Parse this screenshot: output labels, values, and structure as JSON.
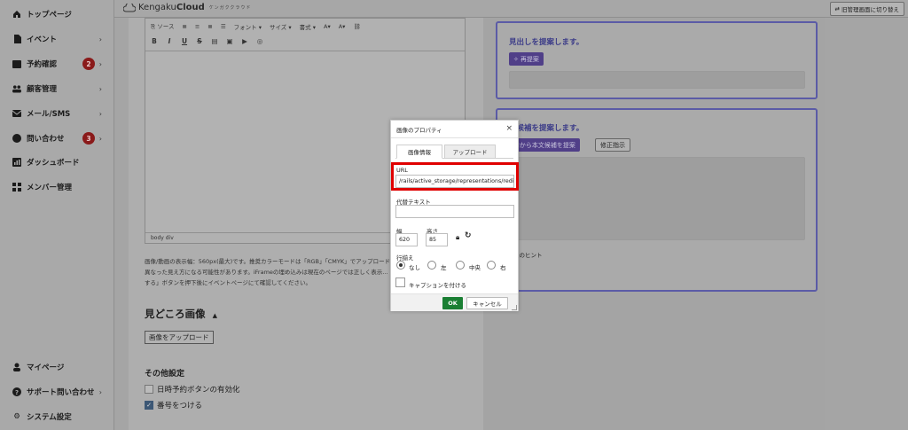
{
  "sidebar": {
    "items": [
      {
        "label": "トップページ",
        "icon": "home-icon",
        "chevron": false,
        "badge": ""
      },
      {
        "label": "イベント",
        "icon": "document-icon",
        "chevron": true,
        "badge": ""
      },
      {
        "label": "予約確認",
        "icon": "calendar-icon",
        "chevron": true,
        "badge": "2"
      },
      {
        "label": "顧客管理",
        "icon": "users-icon",
        "chevron": true,
        "badge": ""
      },
      {
        "label": "メール/SMS",
        "icon": "mail-icon",
        "chevron": true,
        "badge": ""
      },
      {
        "label": "問い合わせ",
        "icon": "chat-icon",
        "chevron": true,
        "badge": "3"
      },
      {
        "label": "ダッシュボード",
        "icon": "chart-icon",
        "chevron": false,
        "badge": ""
      },
      {
        "label": "メンバー管理",
        "icon": "grid-icon",
        "chevron": false,
        "badge": ""
      }
    ],
    "bottom_items": [
      {
        "label": "マイページ",
        "icon": "person-icon",
        "chevron": false
      },
      {
        "label": "サポート問い合わせ",
        "icon": "help-icon",
        "chevron": true
      },
      {
        "label": "システム設定",
        "icon": "gear-icon",
        "chevron": false
      }
    ]
  },
  "header": {
    "logo_prefix": "Kengaku",
    "logo_bold": "Cloud",
    "logo_sub": "ケンガククラウド",
    "switch_label": "旧管理画面に切り替え"
  },
  "editor": {
    "toolbar1": [
      "ソース",
      "フォント",
      "サイズ",
      "書式"
    ],
    "toolbar2": [
      "B",
      "I",
      "U",
      "S"
    ],
    "status": "body  div"
  },
  "main": {
    "note": "画像/動画の表示幅：560px(最大)です。推奨カラーモードは「RGB」「CMYK」でアップロードし…は異なった見え方になる可能性があります。iFrameの埋め込みは現在のページでは正しく表示…「更新する」ボタンを押下後にイベントページにて確認してください。",
    "section_title": "見どころ画像",
    "section_caret": "▲",
    "upload_label": "画像をアップロード",
    "other_title": "その他設定",
    "opt1_label": "日時予約ボタンの有効化",
    "opt2_label": "番号をつける"
  },
  "right": {
    "panel1_title": "見出しを提案します。",
    "panel1_button": "再提案",
    "panel2_title": "文候補を提案します。",
    "panel2_ai_button": "AIから本文候補を提案",
    "panel2_fix_button": "修正指示",
    "panel2_hint": "像のヒント"
  },
  "dialog": {
    "title": "画像のプロパティ",
    "close": "×",
    "tab_info": "画像情報",
    "tab_upload": "アップロード",
    "url_label": "URL",
    "url_value": "/rails/active_storage/representations/redirect",
    "alt_label": "代替テキスト",
    "alt_value": "",
    "width_label": "幅",
    "width_value": "620",
    "height_label": "高さ",
    "height_value": "85",
    "align_label": "行揃え",
    "align_options": [
      "なし",
      "左",
      "中央",
      "右"
    ],
    "align_selected": "なし",
    "caption_label": "キャプションを付ける",
    "ok_label": "OK",
    "cancel_label": "キャンセル"
  },
  "colors": {
    "ok_green": "#1a7f33",
    "highlight_red": "#e00000",
    "panel_border": "#5b5ba6",
    "badge_red": "#8a1a1a"
  }
}
